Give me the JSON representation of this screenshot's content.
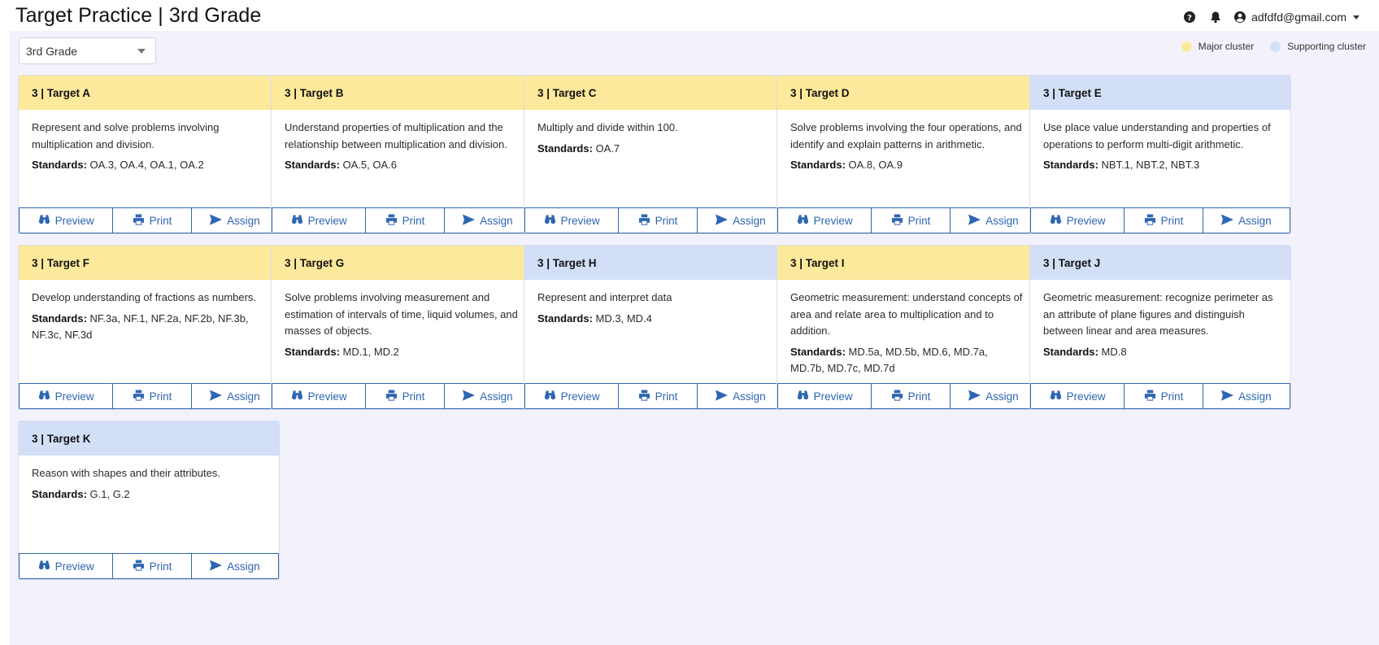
{
  "header": {
    "title": "Target Practice | 3rd Grade",
    "user_email": "adfdfd@gmail.com",
    "icons": [
      "help-icon",
      "bell-icon",
      "user-circle-icon",
      "caret-down-icon"
    ]
  },
  "grade_select": {
    "value": "3rd Grade"
  },
  "legend": {
    "major": {
      "label": "Major cluster",
      "color": "#fde99b"
    },
    "supporting": {
      "label": "Supporting cluster",
      "color": "#d2dff7"
    }
  },
  "actions": {
    "preview": "Preview",
    "print": "Print",
    "assign": "Assign"
  },
  "standards_label": "Standards:",
  "cards": [
    {
      "title": "3 | Target A",
      "cluster": "major",
      "description": "Represent and solve problems involving multiplication and division.",
      "standards": "OA.3, OA.4, OA.1, OA.2"
    },
    {
      "title": "3 | Target B",
      "cluster": "major",
      "description": "Understand properties of multiplication and the relationship between multiplication and division.",
      "standards": "OA.5, OA.6"
    },
    {
      "title": "3 | Target C",
      "cluster": "major",
      "description": "Multiply and divide within 100.",
      "standards": "OA.7"
    },
    {
      "title": "3 | Target D",
      "cluster": "major",
      "description": "Solve problems involving the four operations, and identify and explain patterns in arithmetic.",
      "standards": "OA.8, OA.9"
    },
    {
      "title": "3 | Target E",
      "cluster": "supporting",
      "description": "Use place value understanding and properties of operations to perform multi-digit arithmetic.",
      "standards": "NBT.1, NBT.2, NBT.3"
    },
    {
      "title": "3 | Target F",
      "cluster": "major",
      "description": "Develop understanding of fractions as numbers.",
      "standards": "NF.3a, NF.1, NF.2a, NF.2b, NF.3b, NF.3c, NF.3d"
    },
    {
      "title": "3 | Target G",
      "cluster": "major",
      "description": "Solve problems involving measurement and estimation of intervals of time, liquid volumes, and masses of objects.",
      "standards": "MD.1, MD.2"
    },
    {
      "title": "3 | Target H",
      "cluster": "supporting",
      "description": "Represent and interpret data",
      "standards": "MD.3, MD.4"
    },
    {
      "title": "3 | Target I",
      "cluster": "major",
      "description": "Geometric measurement: understand concepts of area and relate area to multiplication and to addition.",
      "standards": "MD.5a, MD.5b, MD.6, MD.7a, MD.7b, MD.7c, MD.7d"
    },
    {
      "title": "3 | Target J",
      "cluster": "supporting",
      "description": "Geometric measurement: recognize perimeter as an attribute of plane figures and distinguish between linear and area measures.",
      "standards": "MD.8"
    },
    {
      "title": "3 | Target K",
      "cluster": "supporting",
      "description": "Reason with shapes and their attributes.",
      "standards": "G.1, G.2"
    }
  ]
}
